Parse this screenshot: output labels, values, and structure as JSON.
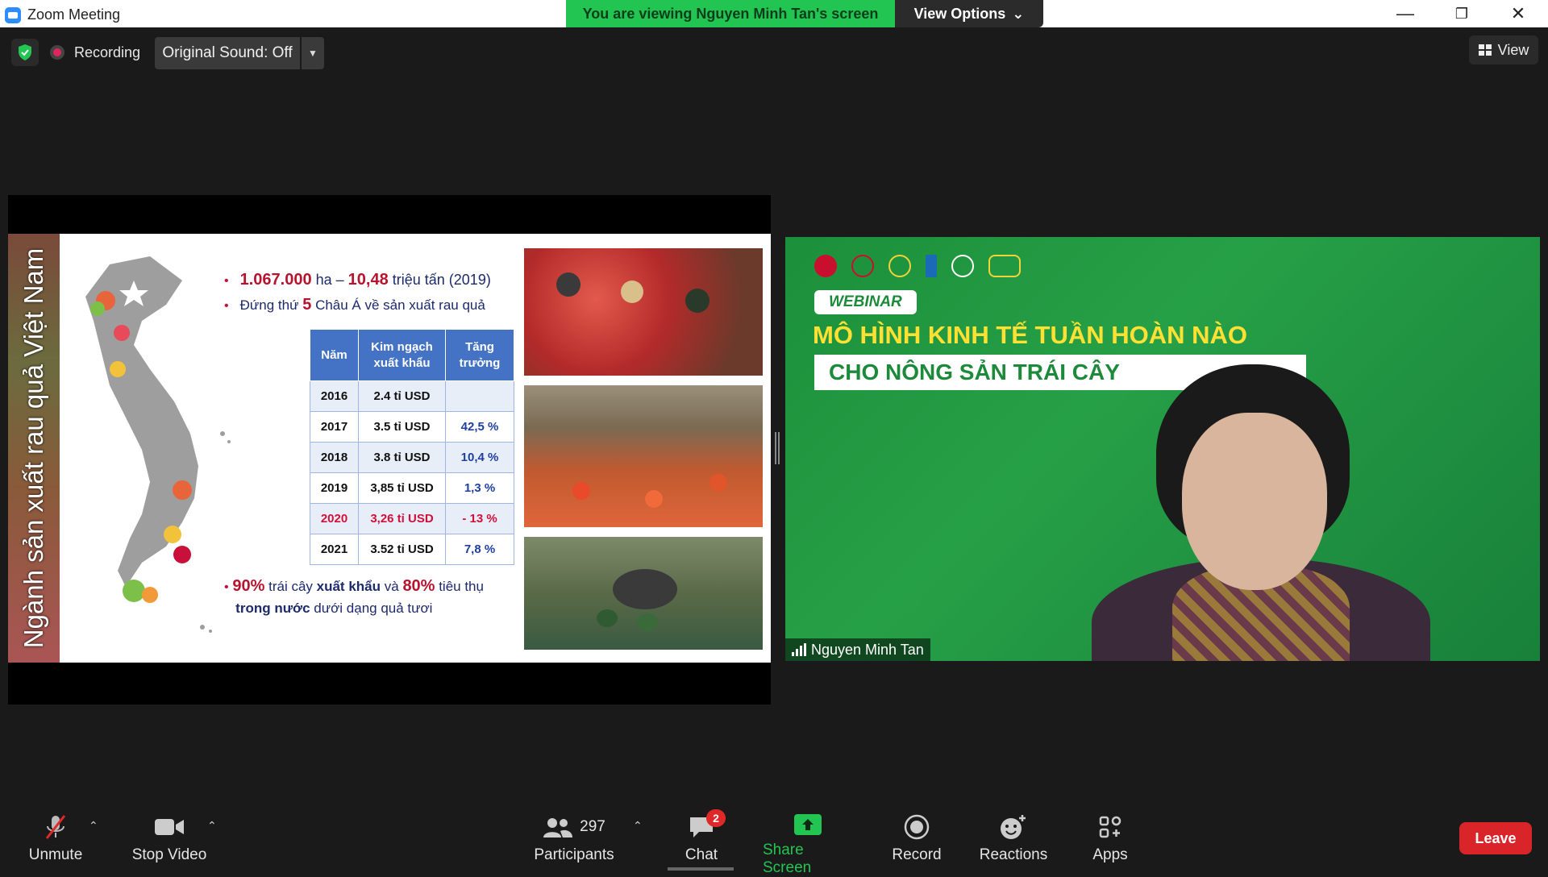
{
  "window": {
    "title": "Zoom Meeting",
    "banner": "You are viewing Nguyen Minh Tan's screen",
    "view_options": "View Options"
  },
  "topbar": {
    "recording": "Recording",
    "original_sound": "Original Sound: Off",
    "view": "View"
  },
  "slide": {
    "vertical_title": "Ngành sản xuất rau quả Việt Nam",
    "bullet1_area": "1.067.000",
    "bullet1_mid": "ha –",
    "bullet1_tons": "10,48",
    "bullet1_tail": "triệu tấn (2019)",
    "bullet2_pre": "Đứng thứ",
    "bullet2_rank": "5",
    "bullet2_tail": "Châu Á về sản xuất rau quả",
    "table": {
      "headers": [
        "Năm",
        "Kim ngạch xuất khẩu",
        "Tăng trưởng"
      ],
      "rows": [
        [
          "2016",
          "2.4 tỉ USD",
          ""
        ],
        [
          "2017",
          "3.5 tỉ USD",
          "42,5 %"
        ],
        [
          "2018",
          "3.8 tỉ USD",
          "10,4 %"
        ],
        [
          "2019",
          "3,85 tỉ USD",
          "1,3 %"
        ],
        [
          "2020",
          "3,26 tỉ USD",
          "-    13 %"
        ],
        [
          "2021",
          "3.52 tỉ USD",
          "7,8 %"
        ]
      ]
    },
    "note_pct1": "90%",
    "note_mid1": "trái cây",
    "note_export": "xuất khẩu",
    "note_and": "và",
    "note_pct2": "80%",
    "note_consume": "tiêu thụ",
    "note_domestic": "trong nước",
    "note_tail": "dưới dạng quả tươi"
  },
  "camera": {
    "webinar": "WEBINAR",
    "headline": "MÔ HÌNH KINH TẾ TUẦN HOÀN NÀO",
    "subline": "CHO NÔNG SẢN TRÁI CÂY",
    "name": "Nguyen Minh Tan"
  },
  "toolbar": {
    "unmute": "Unmute",
    "stop_video": "Stop Video",
    "participants_count": "297",
    "participants": "Participants",
    "chat": "Chat",
    "chat_badge": "2",
    "share_screen": "Share Screen",
    "record": "Record",
    "reactions": "Reactions",
    "apps": "Apps",
    "leave": "Leave"
  },
  "colors": {
    "banner_green": "#23c552",
    "leave_red": "#d9252a",
    "share_green": "#23c552"
  }
}
